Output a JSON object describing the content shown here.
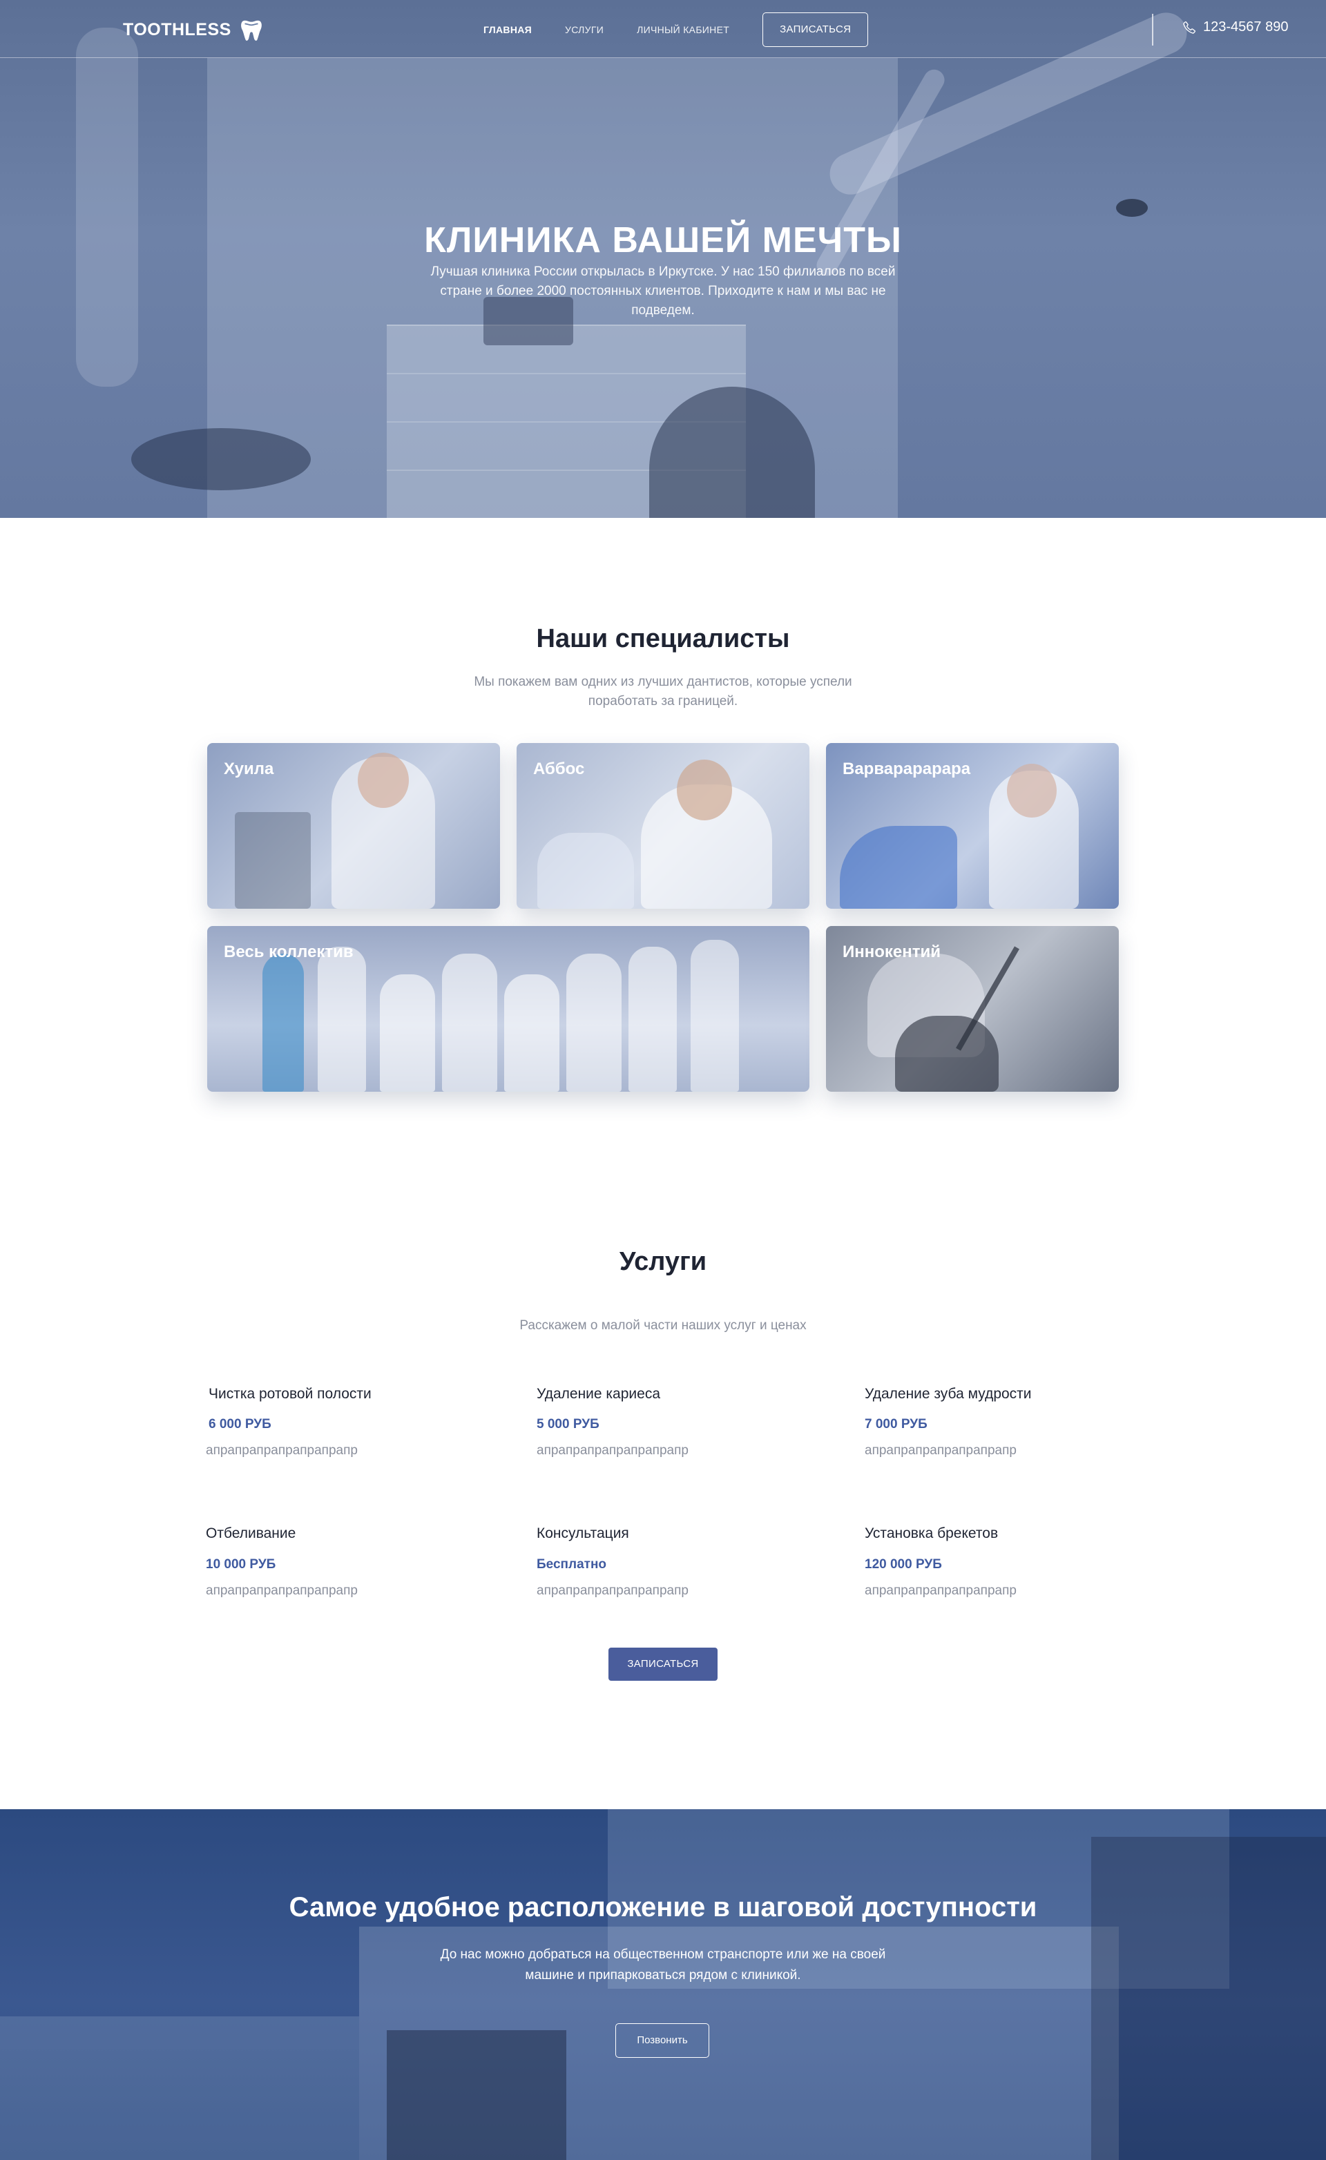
{
  "nav": {
    "brand": "TOOTHLESS",
    "items": [
      {
        "label": "Главная",
        "active": true
      },
      {
        "label": "Услуги",
        "active": false
      },
      {
        "label": "Личный кабинет",
        "active": false
      }
    ],
    "cta_label": "Записаться",
    "phone": "123-4567 890",
    "icons": {
      "logo": "tooth-icon",
      "phone": "phone-icon"
    }
  },
  "hero": {
    "title": "КЛИНИКА ВАШЕЙ МЕЧТЫ",
    "subtitle": "Лучшая клиника России открылась в Иркутске. У нас 150 филиалов по всей стране и более 2000 постоянных клиентов. Приходите к нам и мы вас не подведем."
  },
  "specialists": {
    "title": "Наши специалисты",
    "subtitle": "Мы покажем вам одних из лучших дантистов, которые успели поработать за границей.",
    "cards": [
      {
        "name": "Хуила"
      },
      {
        "name": "Аббос"
      },
      {
        "name": "Варварарарара"
      },
      {
        "name": "Весь коллектив"
      },
      {
        "name": "Иннокентий"
      }
    ]
  },
  "services": {
    "title": "Услуги",
    "subtitle": "Расскажем о малой части наших услуг и ценах",
    "items": [
      {
        "name": "Чистка ротовой полости",
        "price": "6 000 РУБ",
        "desc": "апрапрапрапрапрапрапр"
      },
      {
        "name": "Удаление кариеса",
        "price": "5 000 РУБ",
        "desc": "апрапрапрапрапрапрапр"
      },
      {
        "name": "Удаление зуба мудрости",
        "price": "7 000 РУБ",
        "desc": "апрапрапрапрапрапрапр"
      },
      {
        "name": "Отбеливание",
        "price": "10 000 РУБ",
        "desc": "апрапрапрапрапрапрапр"
      },
      {
        "name": "Консультация",
        "price": "Бесплатно",
        "desc": "апрапрапрапрапрапрапр"
      },
      {
        "name": "Установка брекетов",
        "price": "120 000 РУБ",
        "desc": "апрапрапрапрапрапрапр"
      }
    ],
    "cta_label": "Записаться"
  },
  "location": {
    "title": "Самое удобное расположение в шаговой доступности",
    "subtitle": "До нас можно добраться на общественном странспорте или же на своей машине и припарковаться рядом с клиникой.",
    "cta_label": "Позвонить"
  },
  "colors": {
    "accent": "#4a5d9c",
    "price": "#3f5aa0",
    "hero_overlay": "#5c7096",
    "location_overlay": "#2c4a80",
    "heading": "#1f2433",
    "muted": "#8a8f9c"
  }
}
